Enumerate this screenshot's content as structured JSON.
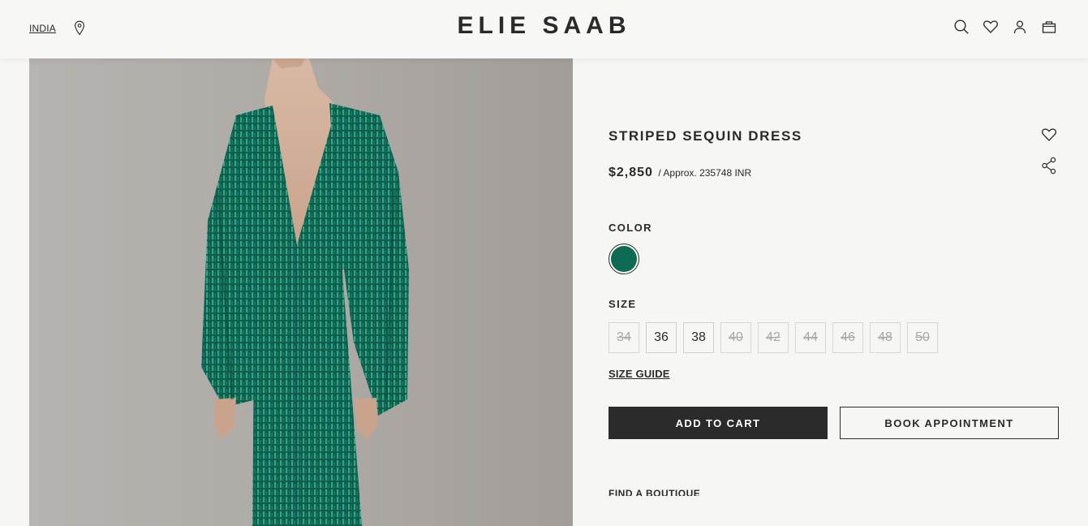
{
  "header": {
    "country": "INDIA",
    "logo": "ELIE SAAB",
    "icons": [
      "location-pin-icon",
      "search-icon",
      "heart-icon",
      "account-icon",
      "bag-icon"
    ]
  },
  "product": {
    "name": "STRIPED SEQUIN DRESS",
    "price": "$2,850",
    "approx": "/ Approx. 235748 INR",
    "color_label": "COLOR",
    "color_swatch": "#0d6b54",
    "size_label": "SIZE",
    "sizes": [
      {
        "label": "34",
        "available": false
      },
      {
        "label": "36",
        "available": true
      },
      {
        "label": "38",
        "available": true
      },
      {
        "label": "40",
        "available": false
      },
      {
        "label": "42",
        "available": false
      },
      {
        "label": "44",
        "available": false
      },
      {
        "label": "46",
        "available": false
      },
      {
        "label": "48",
        "available": false
      },
      {
        "label": "50",
        "available": false
      }
    ],
    "size_guide": "SIZE GUIDE",
    "add_to_cart": "ADD TO CART",
    "book_appointment": "BOOK APPOINTMENT",
    "find_boutique": "FIND A BOUTIQUE"
  },
  "colors": {
    "accent": "#2b2b2b",
    "background": "#f6f6f4",
    "dress": "#0d6b54"
  }
}
